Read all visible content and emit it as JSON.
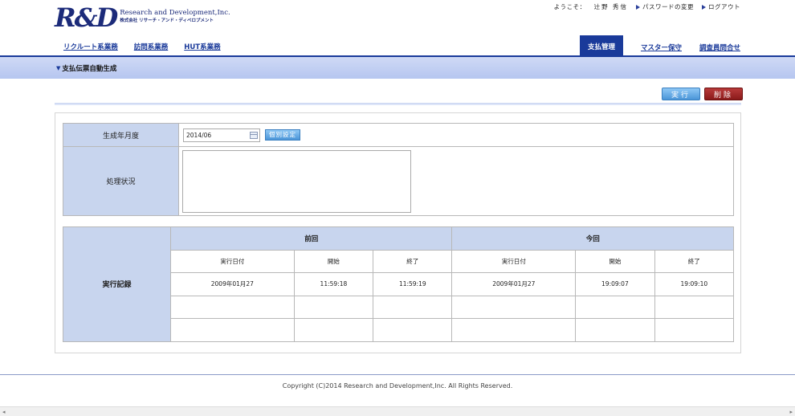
{
  "brand": {
    "logo_mark": "R&D",
    "name_en": "Research and Development,Inc.",
    "name_jp": "株式会社 リサーチ・アンド・ディベロプメント"
  },
  "user_bar": {
    "welcome": "ようこそ：",
    "user_name": "辻野 秀信",
    "password_change": "パスワードの変更",
    "logout": "ログアウト"
  },
  "nav_left": [
    "リクルート系業務",
    "訪問系業務",
    "HUT系業務"
  ],
  "nav_right": [
    "支払管理",
    "マスター保守",
    "調査員問合せ"
  ],
  "nav_active": "支払管理",
  "subheader": {
    "title": "支払伝票自動生成"
  },
  "actions": {
    "execute": "実行",
    "delete": "削除"
  },
  "form": {
    "period_label": "生成年月度",
    "period_value": "2014/06",
    "individual_button": "個別設定",
    "status_label": "処理状況",
    "status_value": ""
  },
  "record": {
    "label": "実行記録",
    "groups": [
      "前回",
      "今回"
    ],
    "columns": [
      "実行日付",
      "開始",
      "終了",
      "実行日付",
      "開始",
      "終了"
    ],
    "rows": [
      [
        "2009年01月27",
        "11:59:18",
        "11:59:19",
        "2009年01月27",
        "19:09:07",
        "19:09:10"
      ],
      [
        "",
        "",
        "",
        "",
        "",
        ""
      ],
      [
        "",
        "",
        "",
        "",
        "",
        ""
      ]
    ]
  },
  "footer": {
    "copyright": "Copyright (C)2014 Research and Development,Inc. All Rights Reserved."
  },
  "colors": {
    "brand_blue": "#1a3a9a",
    "label_bg": "#c8d5ee",
    "execute_btn": "#4a95d8",
    "delete_btn": "#8a1a1a"
  }
}
